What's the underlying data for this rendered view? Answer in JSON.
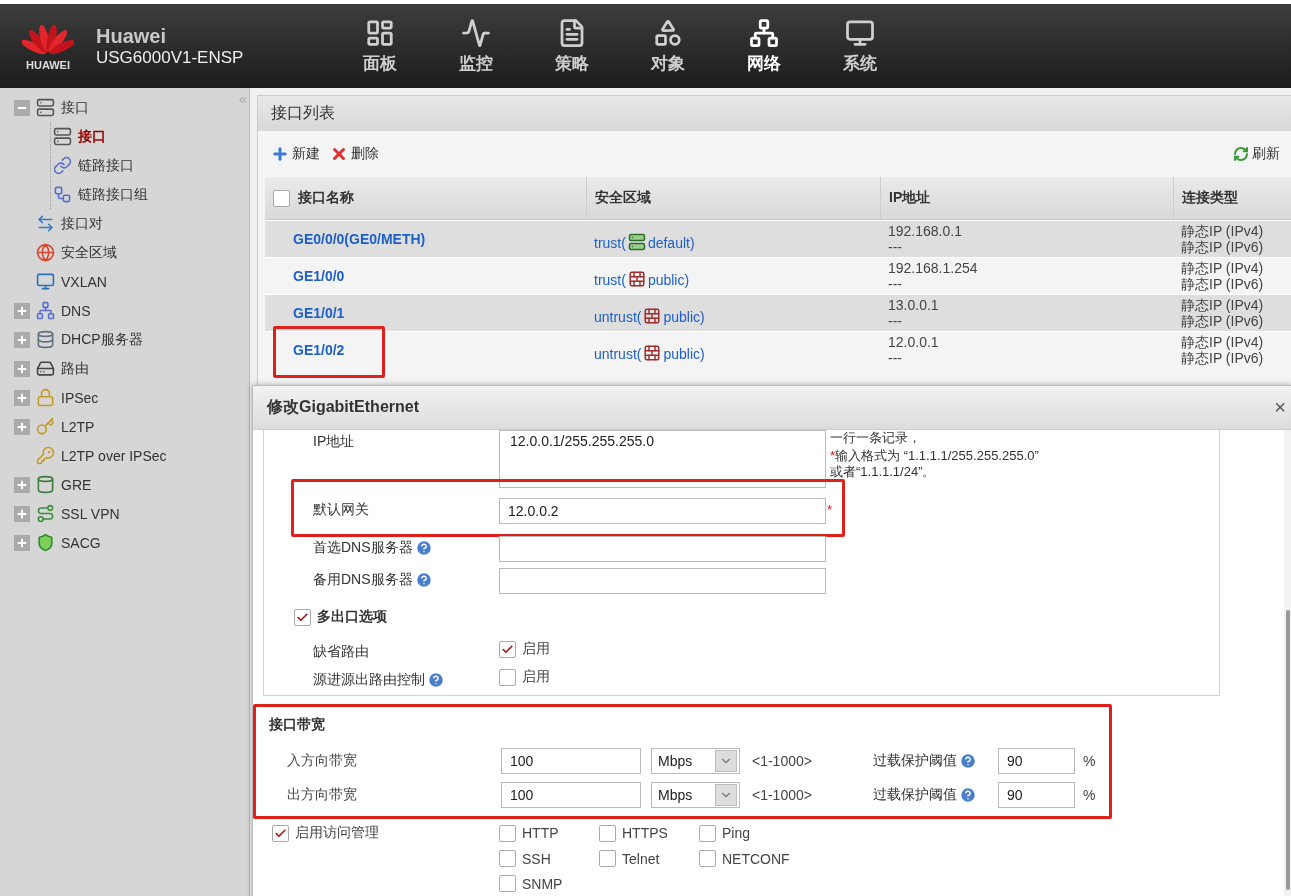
{
  "header": {
    "logo_text": "HUAWEI",
    "brand": "Huawei",
    "model": "USG6000V1-ENSP",
    "nav": [
      {
        "kind": "dashboard",
        "label": "面板",
        "selected": false
      },
      {
        "kind": "monitor",
        "label": "监控",
        "selected": false
      },
      {
        "kind": "policy",
        "label": "策略",
        "selected": false
      },
      {
        "kind": "object",
        "label": "对象",
        "selected": false
      },
      {
        "kind": "network",
        "label": "网络",
        "selected": true
      },
      {
        "kind": "system",
        "label": "系统",
        "selected": false
      }
    ]
  },
  "sidebar": {
    "collapse_glyph": "«",
    "items": [
      {
        "kind": "interface",
        "label": "接口",
        "expanded": true,
        "selected": false,
        "children": [
          {
            "kind": "interface",
            "label": "接口",
            "selected": true
          },
          {
            "kind": "link",
            "label": "链路接口",
            "selected": false
          },
          {
            "kind": "linkgroup",
            "label": "链路接口组",
            "selected": false
          }
        ]
      },
      {
        "kind": "pair",
        "label": "接口对",
        "selected": false
      },
      {
        "kind": "zone",
        "label": "安全区域",
        "selected": false
      },
      {
        "kind": "vxlan",
        "label": "VXLAN",
        "selected": false
      },
      {
        "kind": "dns",
        "label": "DNS",
        "expanded": false,
        "selected": false
      },
      {
        "kind": "dhcp",
        "label": "DHCP服务器",
        "expanded": false,
        "selected": false
      },
      {
        "kind": "route",
        "label": "路由",
        "expanded": false,
        "selected": false
      },
      {
        "kind": "ipsec",
        "label": "IPSec",
        "expanded": false,
        "selected": false
      },
      {
        "kind": "l2tp",
        "label": "L2TP",
        "expanded": false,
        "selected": false
      },
      {
        "kind": "l2tpipsec",
        "label": "L2TP over IPSec",
        "selected": false
      },
      {
        "kind": "gre",
        "label": "GRE",
        "expanded": false,
        "selected": false
      },
      {
        "kind": "sslvpn",
        "label": "SSL VPN",
        "expanded": false,
        "selected": false
      },
      {
        "kind": "sacg",
        "label": "SACG",
        "expanded": false,
        "selected": false
      }
    ]
  },
  "panel": {
    "title": "接口列表",
    "toolbar": [
      {
        "kind": "add",
        "label": "新建"
      },
      {
        "kind": "delete",
        "label": "删除"
      }
    ],
    "refresh": "刷新",
    "table": {
      "select_all": false,
      "columns": [
        "接口名称",
        "安全区域",
        "IP地址",
        "连接类型"
      ],
      "rows": [
        {
          "name": "GE0/0/0(GE0/METH)",
          "zone": "trust(",
          "kind": "default",
          "vsys": "default)",
          "ip": [
            "192.168.0.1",
            "---"
          ],
          "type": [
            "静态IP (IPv4)",
            "静态IP (IPv6)"
          ],
          "highlighted": false
        },
        {
          "name": "GE1/0/0",
          "zone": "trust(",
          "kind": "public",
          "vsys": "public)",
          "ip": [
            "192.168.1.254",
            "---"
          ],
          "type": [
            "静态IP (IPv4)",
            "静态IP (IPv6)"
          ],
          "highlighted": false
        },
        {
          "name": "GE1/0/1",
          "zone": "untrust(",
          "kind": "public",
          "vsys": "public)",
          "ip": [
            "13.0.0.1",
            "---"
          ],
          "type": [
            "静态IP (IPv4)",
            "静态IP (IPv6)"
          ],
          "highlighted": false
        },
        {
          "name": "GE1/0/2",
          "zone": "untrust(",
          "kind": "public",
          "vsys": "public)",
          "ip": [
            "12.0.0.1",
            "---"
          ],
          "type": [
            "静态IP (IPv4)",
            "静态IP (IPv6)"
          ],
          "highlighted": true
        }
      ]
    }
  },
  "dialog": {
    "title": "修改GigabitEthernet",
    "close": "×",
    "ip": {
      "label": "IP地址",
      "value": "12.0.0.1/255.255.255.0",
      "hint_1": "一行一条记录，",
      "required_mark": "*",
      "hint_2": "输入格式为 “1.1.1.1/255.255.255.0”",
      "hint_3": "或者“1.1.1.1/24”。"
    },
    "gateway": {
      "label": "默认网关",
      "value": "12.0.0.2",
      "required_mark": "*",
      "highlighted": true
    },
    "dns": [
      {
        "label": "首选DNS服务器",
        "help": true
      },
      {
        "label": "备用DNS服务器",
        "help": true
      }
    ],
    "multi_exit": {
      "label": "多出口选项",
      "checked": true,
      "options": [
        {
          "label": "缺省路由",
          "help": false,
          "option": "启用",
          "checked": true
        },
        {
          "label": "源进源出路由控制",
          "help": true,
          "option": "启用",
          "checked": false
        }
      ]
    },
    "bandwidth": {
      "title": "接口带宽",
      "highlighted": true,
      "rows": [
        {
          "label": "入方向带宽",
          "value": "100",
          "unit": "Mbps",
          "range": "<1-1000>",
          "threshold_label": "过载保护阈值",
          "threshold": "90",
          "percent": "%"
        },
        {
          "label": "出方向带宽",
          "value": "100",
          "unit": "Mbps",
          "range": "<1-1000>",
          "threshold_label": "过载保护阈值",
          "threshold": "90",
          "percent": "%"
        }
      ]
    },
    "access": {
      "label": "启用访问管理",
      "checked": true,
      "options": [
        {
          "label": "HTTP",
          "checked": false
        },
        {
          "label": "HTTPS",
          "checked": false
        },
        {
          "label": "Ping",
          "checked": false
        },
        {
          "label": "SSH",
          "checked": false
        },
        {
          "label": "Telnet",
          "checked": false
        },
        {
          "label": "NETCONF",
          "checked": false
        },
        {
          "label": "SNMP",
          "checked": false
        }
      ]
    }
  }
}
